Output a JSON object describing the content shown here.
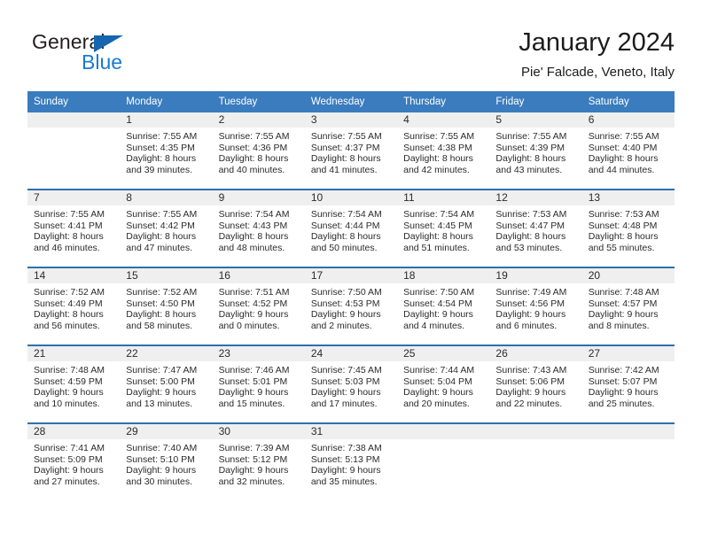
{
  "brand": {
    "name_part1": "General",
    "name_part2": "Blue",
    "accent_color": "#1a7ad1",
    "triangle_color": "#1565b0"
  },
  "header": {
    "title": "January 2024",
    "subtitle": "Pie' Falcade, Veneto, Italy"
  },
  "calendar": {
    "header_bg": "#3a7cbe",
    "separator_color": "#2f6fae",
    "daynum_bg": "#efefef",
    "weekday_headers": [
      "Sunday",
      "Monday",
      "Tuesday",
      "Wednesday",
      "Thursday",
      "Friday",
      "Saturday"
    ],
    "weeks": [
      [
        {
          "day": "",
          "sunrise": "",
          "sunset": "",
          "daylight_line1": "",
          "daylight_line2": "",
          "empty": true
        },
        {
          "day": "1",
          "sunrise": "Sunrise: 7:55 AM",
          "sunset": "Sunset: 4:35 PM",
          "daylight_line1": "Daylight: 8 hours",
          "daylight_line2": "and 39 minutes."
        },
        {
          "day": "2",
          "sunrise": "Sunrise: 7:55 AM",
          "sunset": "Sunset: 4:36 PM",
          "daylight_line1": "Daylight: 8 hours",
          "daylight_line2": "and 40 minutes."
        },
        {
          "day": "3",
          "sunrise": "Sunrise: 7:55 AM",
          "sunset": "Sunset: 4:37 PM",
          "daylight_line1": "Daylight: 8 hours",
          "daylight_line2": "and 41 minutes."
        },
        {
          "day": "4",
          "sunrise": "Sunrise: 7:55 AM",
          "sunset": "Sunset: 4:38 PM",
          "daylight_line1": "Daylight: 8 hours",
          "daylight_line2": "and 42 minutes."
        },
        {
          "day": "5",
          "sunrise": "Sunrise: 7:55 AM",
          "sunset": "Sunset: 4:39 PM",
          "daylight_line1": "Daylight: 8 hours",
          "daylight_line2": "and 43 minutes."
        },
        {
          "day": "6",
          "sunrise": "Sunrise: 7:55 AM",
          "sunset": "Sunset: 4:40 PM",
          "daylight_line1": "Daylight: 8 hours",
          "daylight_line2": "and 44 minutes."
        }
      ],
      [
        {
          "day": "7",
          "sunrise": "Sunrise: 7:55 AM",
          "sunset": "Sunset: 4:41 PM",
          "daylight_line1": "Daylight: 8 hours",
          "daylight_line2": "and 46 minutes."
        },
        {
          "day": "8",
          "sunrise": "Sunrise: 7:55 AM",
          "sunset": "Sunset: 4:42 PM",
          "daylight_line1": "Daylight: 8 hours",
          "daylight_line2": "and 47 minutes."
        },
        {
          "day": "9",
          "sunrise": "Sunrise: 7:54 AM",
          "sunset": "Sunset: 4:43 PM",
          "daylight_line1": "Daylight: 8 hours",
          "daylight_line2": "and 48 minutes."
        },
        {
          "day": "10",
          "sunrise": "Sunrise: 7:54 AM",
          "sunset": "Sunset: 4:44 PM",
          "daylight_line1": "Daylight: 8 hours",
          "daylight_line2": "and 50 minutes."
        },
        {
          "day": "11",
          "sunrise": "Sunrise: 7:54 AM",
          "sunset": "Sunset: 4:45 PM",
          "daylight_line1": "Daylight: 8 hours",
          "daylight_line2": "and 51 minutes."
        },
        {
          "day": "12",
          "sunrise": "Sunrise: 7:53 AM",
          "sunset": "Sunset: 4:47 PM",
          "daylight_line1": "Daylight: 8 hours",
          "daylight_line2": "and 53 minutes."
        },
        {
          "day": "13",
          "sunrise": "Sunrise: 7:53 AM",
          "sunset": "Sunset: 4:48 PM",
          "daylight_line1": "Daylight: 8 hours",
          "daylight_line2": "and 55 minutes."
        }
      ],
      [
        {
          "day": "14",
          "sunrise": "Sunrise: 7:52 AM",
          "sunset": "Sunset: 4:49 PM",
          "daylight_line1": "Daylight: 8 hours",
          "daylight_line2": "and 56 minutes."
        },
        {
          "day": "15",
          "sunrise": "Sunrise: 7:52 AM",
          "sunset": "Sunset: 4:50 PM",
          "daylight_line1": "Daylight: 8 hours",
          "daylight_line2": "and 58 minutes."
        },
        {
          "day": "16",
          "sunrise": "Sunrise: 7:51 AM",
          "sunset": "Sunset: 4:52 PM",
          "daylight_line1": "Daylight: 9 hours",
          "daylight_line2": "and 0 minutes."
        },
        {
          "day": "17",
          "sunrise": "Sunrise: 7:50 AM",
          "sunset": "Sunset: 4:53 PM",
          "daylight_line1": "Daylight: 9 hours",
          "daylight_line2": "and 2 minutes."
        },
        {
          "day": "18",
          "sunrise": "Sunrise: 7:50 AM",
          "sunset": "Sunset: 4:54 PM",
          "daylight_line1": "Daylight: 9 hours",
          "daylight_line2": "and 4 minutes."
        },
        {
          "day": "19",
          "sunrise": "Sunrise: 7:49 AM",
          "sunset": "Sunset: 4:56 PM",
          "daylight_line1": "Daylight: 9 hours",
          "daylight_line2": "and 6 minutes."
        },
        {
          "day": "20",
          "sunrise": "Sunrise: 7:48 AM",
          "sunset": "Sunset: 4:57 PM",
          "daylight_line1": "Daylight: 9 hours",
          "daylight_line2": "and 8 minutes."
        }
      ],
      [
        {
          "day": "21",
          "sunrise": "Sunrise: 7:48 AM",
          "sunset": "Sunset: 4:59 PM",
          "daylight_line1": "Daylight: 9 hours",
          "daylight_line2": "and 10 minutes."
        },
        {
          "day": "22",
          "sunrise": "Sunrise: 7:47 AM",
          "sunset": "Sunset: 5:00 PM",
          "daylight_line1": "Daylight: 9 hours",
          "daylight_line2": "and 13 minutes."
        },
        {
          "day": "23",
          "sunrise": "Sunrise: 7:46 AM",
          "sunset": "Sunset: 5:01 PM",
          "daylight_line1": "Daylight: 9 hours",
          "daylight_line2": "and 15 minutes."
        },
        {
          "day": "24",
          "sunrise": "Sunrise: 7:45 AM",
          "sunset": "Sunset: 5:03 PM",
          "daylight_line1": "Daylight: 9 hours",
          "daylight_line2": "and 17 minutes."
        },
        {
          "day": "25",
          "sunrise": "Sunrise: 7:44 AM",
          "sunset": "Sunset: 5:04 PM",
          "daylight_line1": "Daylight: 9 hours",
          "daylight_line2": "and 20 minutes."
        },
        {
          "day": "26",
          "sunrise": "Sunrise: 7:43 AM",
          "sunset": "Sunset: 5:06 PM",
          "daylight_line1": "Daylight: 9 hours",
          "daylight_line2": "and 22 minutes."
        },
        {
          "day": "27",
          "sunrise": "Sunrise: 7:42 AM",
          "sunset": "Sunset: 5:07 PM",
          "daylight_line1": "Daylight: 9 hours",
          "daylight_line2": "and 25 minutes."
        }
      ],
      [
        {
          "day": "28",
          "sunrise": "Sunrise: 7:41 AM",
          "sunset": "Sunset: 5:09 PM",
          "daylight_line1": "Daylight: 9 hours",
          "daylight_line2": "and 27 minutes."
        },
        {
          "day": "29",
          "sunrise": "Sunrise: 7:40 AM",
          "sunset": "Sunset: 5:10 PM",
          "daylight_line1": "Daylight: 9 hours",
          "daylight_line2": "and 30 minutes."
        },
        {
          "day": "30",
          "sunrise": "Sunrise: 7:39 AM",
          "sunset": "Sunset: 5:12 PM",
          "daylight_line1": "Daylight: 9 hours",
          "daylight_line2": "and 32 minutes."
        },
        {
          "day": "31",
          "sunrise": "Sunrise: 7:38 AM",
          "sunset": "Sunset: 5:13 PM",
          "daylight_line1": "Daylight: 9 hours",
          "daylight_line2": "and 35 minutes."
        },
        {
          "day": "",
          "sunrise": "",
          "sunset": "",
          "daylight_line1": "",
          "daylight_line2": "",
          "empty": true
        },
        {
          "day": "",
          "sunrise": "",
          "sunset": "",
          "daylight_line1": "",
          "daylight_line2": "",
          "empty": true
        },
        {
          "day": "",
          "sunrise": "",
          "sunset": "",
          "daylight_line1": "",
          "daylight_line2": "",
          "empty": true
        }
      ]
    ]
  }
}
